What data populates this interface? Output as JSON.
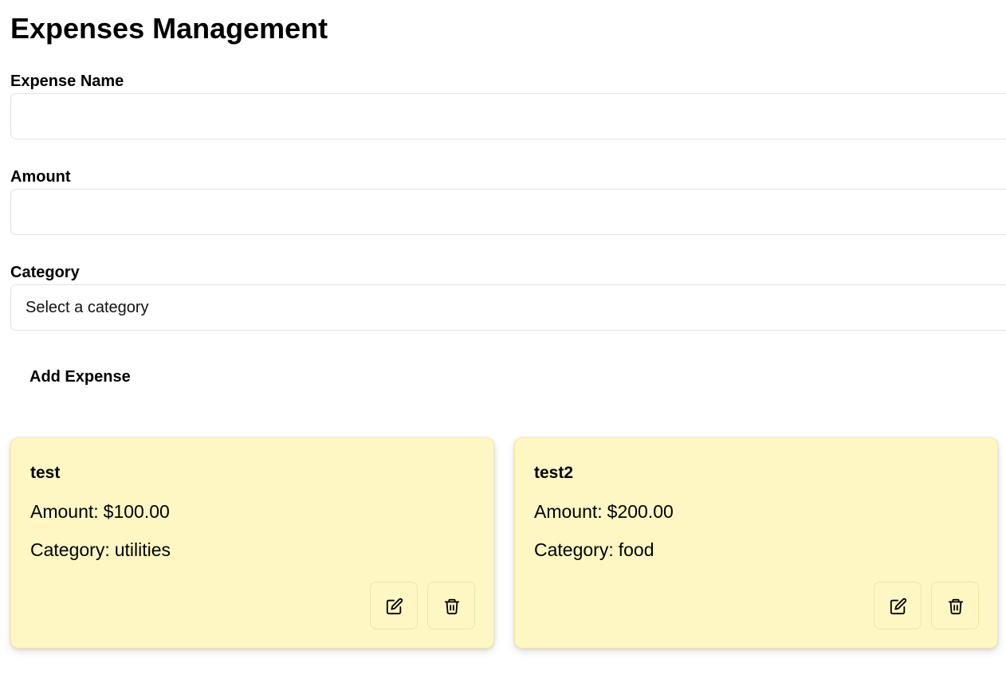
{
  "page": {
    "title": "Expenses Management"
  },
  "form": {
    "name_label": "Expense Name",
    "name_value": "",
    "amount_label": "Amount",
    "amount_value": "",
    "category_label": "Category",
    "category_selected": "Select a category",
    "add_button_label": "Add Expense"
  },
  "expenses": [
    {
      "name": "test",
      "amount_label": "Amount:",
      "amount": "$100.00",
      "category_label": "Category:",
      "category": "utilities",
      "edit_icon": "edit-icon",
      "delete_icon": "trash-icon"
    },
    {
      "name": "test2",
      "amount_label": "Amount:",
      "amount": "$200.00",
      "category_label": "Category:",
      "category": "food",
      "edit_icon": "edit-icon",
      "delete_icon": "trash-icon"
    }
  ],
  "colors": {
    "card_background": "#fef7c3",
    "field_border": "#e3e3e3",
    "text": "#000000"
  }
}
